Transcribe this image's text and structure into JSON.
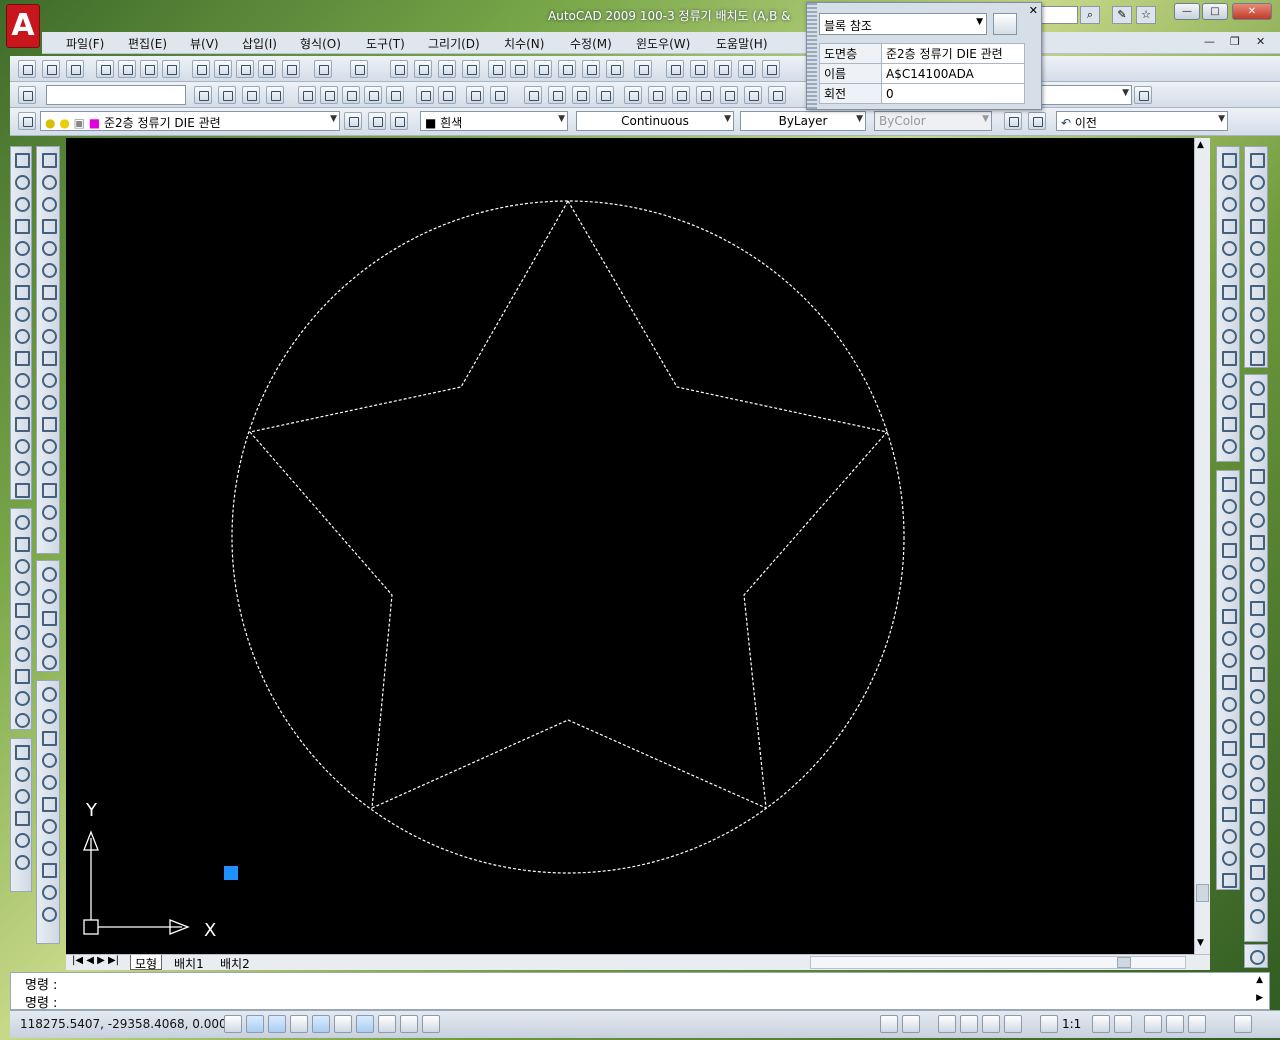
{
  "window": {
    "title": "AutoCAD 2009 100-3 정류기 배치도 (A,B &"
  },
  "menu": [
    "파일(F)",
    "편집(E)",
    "뷰(V)",
    "삽입(I)",
    "형식(O)",
    "도구(T)",
    "그리기(D)",
    "치수(N)",
    "수정(M)",
    "윈도우(W)",
    "도움말(H)"
  ],
  "block_reference": {
    "selector": "블록 참조",
    "properties": [
      {
        "key": "도면층",
        "value": "준2층 정류기 DIE 관련"
      },
      {
        "key": "이름",
        "value": "A$C14100ADA"
      },
      {
        "key": "회전",
        "value": "0"
      }
    ]
  },
  "layers_toolbar": {
    "layer": "준2층 정류기 DIE 관련",
    "color": "흰색",
    "linetype": "Continuous",
    "lineweight": "ByLayer",
    "plotstyle": "ByColor",
    "previous": "이전"
  },
  "ucs": {
    "x_label": "X",
    "y_label": "Y"
  },
  "tabs": [
    "모형",
    "배치1",
    "배치2"
  ],
  "command": {
    "line1": "명령 :",
    "line2": "명령 :"
  },
  "status": {
    "coords": "118275.5407, -29358.4068, 0.0000",
    "scale": "1:1"
  },
  "colors": {
    "drawing_bg": "#000000",
    "geometry": "#ffffff",
    "grip": "#1e90ff"
  }
}
